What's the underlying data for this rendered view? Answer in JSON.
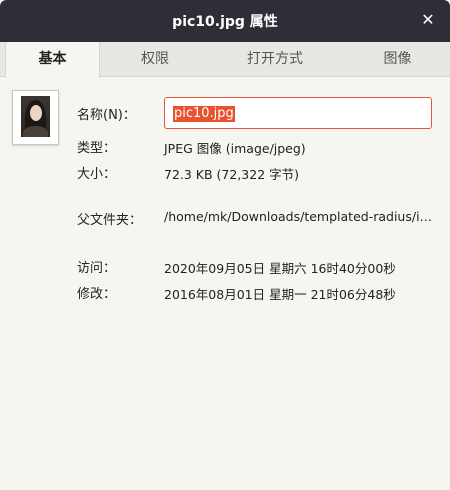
{
  "window": {
    "title": "pic10.jpg 属性",
    "close_glyph": "✕"
  },
  "tabs": [
    {
      "label": "基本",
      "active": true
    },
    {
      "label": "权限",
      "active": false
    },
    {
      "label": "打开方式",
      "active": false
    },
    {
      "label": "图像",
      "active": false
    }
  ],
  "basic": {
    "name_label": "名称(N)：",
    "name_value": "pic10.jpg",
    "type_label": "类型：",
    "type_value": "JPEG 图像 (image/jpeg)",
    "size_label": "大小：",
    "size_value": "72.3 KB (72,322 字节)",
    "parent_label": "父文件夹：",
    "parent_value": "/home/mk/Downloads/templated-radius/i…",
    "accessed_label": "访问：",
    "accessed_value": "2020年09月05日 星期六 16时40分00秒",
    "modified_label": "修改：",
    "modified_value": "2016年08月01日 星期一 21时06分48秒"
  },
  "colors": {
    "titlebar": "#2e2f36",
    "accent": "#e8522f",
    "background": "#f6f5f0"
  }
}
